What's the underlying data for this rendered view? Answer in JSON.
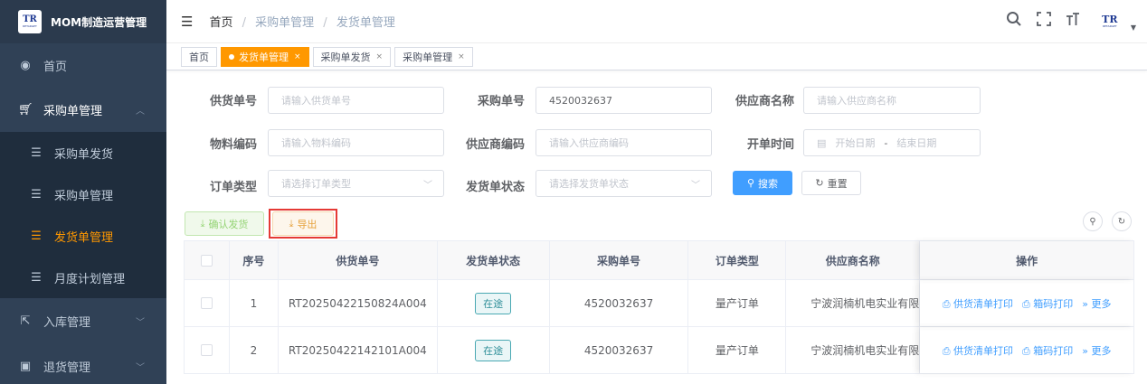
{
  "app": {
    "title": "MOM制造运营管理",
    "logo_text": "TR",
    "logo_sub": "RETARGET",
    "colors": {
      "sidebar_bg": "#304156",
      "accent": "#ff9800",
      "primary": "#409eff"
    }
  },
  "sidebar": {
    "items": [
      {
        "label": "首页",
        "icon": "dashboard-icon"
      },
      {
        "label": "采购单管理",
        "icon": "cart-icon"
      },
      {
        "label": "采购单发货",
        "icon": "list-icon"
      },
      {
        "label": "采购单管理",
        "icon": "list-icon"
      },
      {
        "label": "发货单管理",
        "icon": "list-icon"
      },
      {
        "label": "月度计划管理",
        "icon": "list-icon"
      },
      {
        "label": "入库管理",
        "icon": "external-link-icon"
      },
      {
        "label": "退货管理",
        "icon": "box-icon"
      }
    ]
  },
  "header": {
    "breadcrumb": [
      "首页",
      "采购单管理",
      "发货单管理"
    ]
  },
  "tags": [
    {
      "label": "首页"
    },
    {
      "label": "发货单管理"
    },
    {
      "label": "采购单发货"
    },
    {
      "label": "采购单管理"
    }
  ],
  "form": {
    "supply_no": {
      "label": "供货单号",
      "placeholder": "请输入供货单号"
    },
    "po_no": {
      "label": "采购单号",
      "value": "4520032637"
    },
    "supplier_name": {
      "label": "供应商名称",
      "placeholder": "请输入供应商名称"
    },
    "material_code": {
      "label": "物料编码",
      "placeholder": "请输入物料编码"
    },
    "supplier_code": {
      "label": "供应商编码",
      "placeholder": "请输入供应商编码"
    },
    "open_time": {
      "label": "开单时间",
      "start": "开始日期",
      "sep": "-",
      "end": "结束日期"
    },
    "order_type": {
      "label": "订单类型",
      "placeholder": "请选择订单类型"
    },
    "ship_status": {
      "label": "发货单状态",
      "placeholder": "请选择发货单状态"
    },
    "search_btn": "搜索",
    "reset_btn": "重置"
  },
  "toolbar": {
    "confirm_btn": "确认发货",
    "export_btn": "导出"
  },
  "table": {
    "headers": [
      "序号",
      "供货单号",
      "发货单状态",
      "采购单号",
      "订单类型",
      "供应商名称",
      "操作"
    ],
    "rows": [
      {
        "index": "1",
        "supply_no": "RT20250422150824A004",
        "status": "在途",
        "po_no": "4520032637",
        "order_type": "量产订单",
        "supplier": "宁波润楠机电实业有限"
      },
      {
        "index": "2",
        "supply_no": "RT20250422142101A004",
        "status": "在途",
        "po_no": "4520032637",
        "order_type": "量产订单",
        "supplier": "宁波润楠机电实业有限"
      }
    ],
    "ops": {
      "print_list": "供货清单打印",
      "print_box": "箱码打印",
      "more": "更多"
    }
  }
}
